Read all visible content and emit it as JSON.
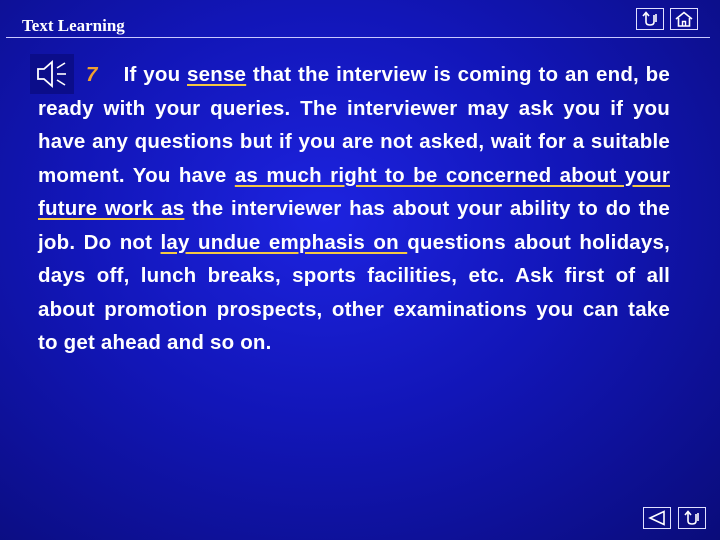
{
  "header": {
    "title": "Text Learning",
    "nav_top": [
      "return-icon",
      "home-icon"
    ]
  },
  "audio": {
    "icon": "speaker-icon"
  },
  "paragraph": {
    "number": "7",
    "t1": "If you ",
    "u1": "sense",
    "t2": " that the interview is coming to an end, be ready with your queries. The interviewer may ask you if you have any questions but if you are not asked, wait for a suitable moment. You have ",
    "u2": "as much right to be concerned about your future work as",
    "t3": " the interviewer has about your ability to do the job. Do not ",
    "u3": "lay undue emphasis on ",
    "t4": "questions about holidays, days off, lunch breaks, sports facilities, etc. Ask first of all about promotion prospects, other examinations you can take to get ahead and so on."
  },
  "nav_bottom": [
    "prev-icon",
    "return-icon"
  ],
  "colors": {
    "background": "#1216b8",
    "accent": "#f0a030",
    "underline": "#f5c842",
    "text": "#ffffff"
  }
}
